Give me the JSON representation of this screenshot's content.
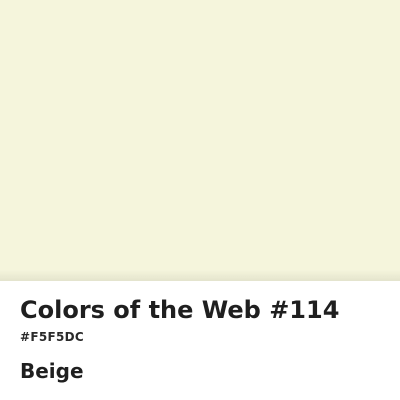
{
  "swatch": {
    "color": "#F5F5DC"
  },
  "info": {
    "title": "Colors of the Web #114",
    "hex": "#F5F5DC",
    "name": "Beige"
  }
}
